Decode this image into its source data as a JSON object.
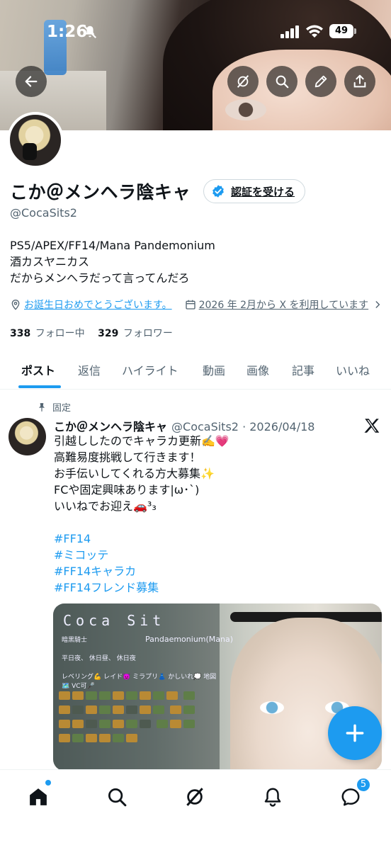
{
  "status_bar": {
    "time": "1:26",
    "battery": "49"
  },
  "profile": {
    "name": "こか＠メンヘラ陰キャ",
    "verify_label": "認証を受ける",
    "handle": "@CocaSits2",
    "bio_lines": [
      "PS5/APEX/FF14/Mana Pandemonium",
      "酒カスヤニカス",
      "だからメンヘラだって言ってんだろ"
    ],
    "birthday": "お誕生日おめでとうございます。",
    "joined": "2026 年 2月から X を利用しています",
    "following_count": "338",
    "following_label": "フォロー中",
    "followers_count": "329",
    "followers_label": "フォロワー"
  },
  "tabs": [
    "ポスト",
    "返信",
    "ハイライト",
    "動画",
    "画像",
    "記事",
    "いいね"
  ],
  "active_tab": "ポスト",
  "post": {
    "pinned_label": "固定",
    "author_name": "こか＠メンヘラ陰キャ",
    "author_handle": "@CocaSits2",
    "date": "· 2026/04/18",
    "lines": [
      "引越ししたのでキャラカ更新✍️💗",
      "高難易度挑戦して行きます！",
      "お手伝いしてくれる方大募集✨",
      "FCや固定興味あります|ω･`)",
      "いいねでお迎え🚗³₃"
    ],
    "hashtags": [
      "#FF14",
      "#ミコッテ",
      "#FF14キャラカ",
      "#FF14フレンド募集"
    ],
    "image": {
      "title": "Coca Sit",
      "server": "Pandaemonium(Mana)",
      "role": "暗黒騎士",
      "times": "平日夜、 休日昼、 休日夜",
      "styles": "レベリング💪 レイド👿 ミラプリ👗 かしいれ💭 地図🗺️ VC可🎤"
    }
  },
  "nav": {
    "messages_badge": "5"
  },
  "colors": {
    "accent": "#1d9bf0",
    "text": "#0f1419",
    "muted": "#536471"
  }
}
